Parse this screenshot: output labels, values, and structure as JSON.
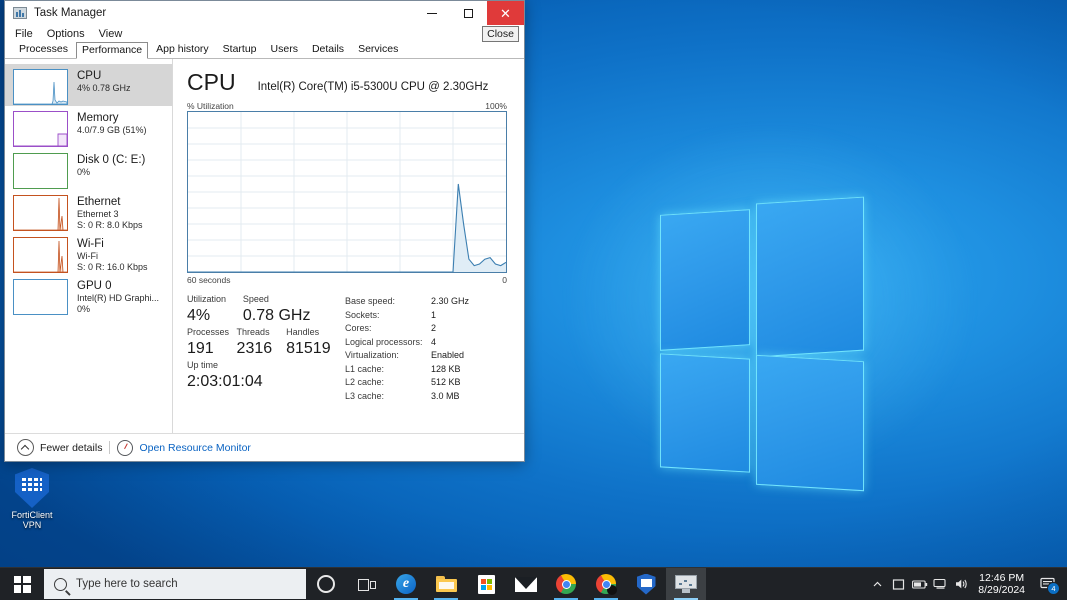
{
  "window": {
    "title": "Task Manager",
    "title_icon": "task-manager-icon",
    "minimize_label": "Minimize",
    "maximize_label": "Maximize",
    "close_label": "Close",
    "close_tooltip": "Close",
    "menus": [
      "File",
      "Options",
      "View"
    ],
    "tabs": [
      {
        "label": "Processes",
        "selected": false
      },
      {
        "label": "Performance",
        "selected": true
      },
      {
        "label": "App history",
        "selected": false
      },
      {
        "label": "Startup",
        "selected": false
      },
      {
        "label": "Users",
        "selected": false
      },
      {
        "label": "Details",
        "selected": false
      },
      {
        "label": "Services",
        "selected": false
      }
    ]
  },
  "sidebar": {
    "items": [
      {
        "title": "CPU",
        "sub1": "4%  0.78 GHz",
        "sub2": "",
        "color": "#4a90c4",
        "selected": true
      },
      {
        "title": "Memory",
        "sub1": "4.0/7.9 GB (51%)",
        "sub2": "",
        "color": "#9b4fc8",
        "selected": false
      },
      {
        "title": "Disk 0 (C: E:)",
        "sub1": "0%",
        "sub2": "",
        "color": "#4f9c4f",
        "selected": false
      },
      {
        "title": "Ethernet",
        "sub1": "Ethernet 3",
        "sub2": "S: 0 R: 8.0 Kbps",
        "color": "#c4521f",
        "selected": false
      },
      {
        "title": "Wi-Fi",
        "sub1": "Wi-Fi",
        "sub2": "S: 0 R: 16.0 Kbps",
        "color": "#c4521f",
        "selected": false
      },
      {
        "title": "GPU 0",
        "sub1": "Intel(R) HD Graphi...",
        "sub2": "0%",
        "color": "#4a90c4",
        "selected": false
      }
    ]
  },
  "cpu": {
    "heading": "CPU",
    "model": "Intel(R) Core(TM) i5-5300U CPU @ 2.30GHz",
    "graph_title": "% Utilization",
    "graph_max": "100%",
    "graph_duration": "60 seconds",
    "graph_min": "0",
    "stats": {
      "utilization_label": "Utilization",
      "utilization_value": "4%",
      "speed_label": "Speed",
      "speed_value": "0.78 GHz",
      "processes_label": "Processes",
      "processes_value": "191",
      "threads_label": "Threads",
      "threads_value": "2316",
      "handles_label": "Handles",
      "handles_value": "81519",
      "uptime_label": "Up time",
      "uptime_value": "2:03:01:04"
    },
    "details": [
      {
        "key": "Base speed:",
        "value": "2.30 GHz"
      },
      {
        "key": "Sockets:",
        "value": "1"
      },
      {
        "key": "Cores:",
        "value": "2"
      },
      {
        "key": "Logical processors:",
        "value": "4"
      },
      {
        "key": "Virtualization:",
        "value": "Enabled"
      },
      {
        "key": "L1 cache:",
        "value": "128 KB"
      },
      {
        "key": "L2 cache:",
        "value": "512 KB"
      },
      {
        "key": "L3 cache:",
        "value": "3.0 MB"
      }
    ]
  },
  "chart_data": {
    "type": "area",
    "title": "% Utilization",
    "xlabel": "60 seconds",
    "ylabel": "% Utilization",
    "ylim": [
      0,
      100
    ],
    "xlim": [
      60,
      0
    ],
    "grid": true,
    "legend": false,
    "axis_labels": {
      "y_top": "100%",
      "y_bottom": "0",
      "x_left": "60 seconds",
      "x_right": "0"
    },
    "line_color": "#3c7fb1",
    "fill_color": "#dbeaf4",
    "x": [
      60,
      59,
      58,
      57,
      56,
      55,
      54,
      53,
      52,
      51,
      50,
      49,
      48,
      47,
      46,
      45,
      44,
      43,
      42,
      41,
      40,
      39,
      38,
      37,
      36,
      35,
      34,
      33,
      32,
      31,
      30,
      29,
      28,
      27,
      26,
      25,
      24,
      23,
      22,
      21,
      20,
      19,
      18,
      17,
      16,
      15,
      14,
      13,
      12,
      11,
      10,
      9,
      8,
      7,
      6,
      5,
      4,
      3,
      2,
      1,
      0
    ],
    "values": [
      0,
      0,
      0,
      0,
      0,
      0,
      0,
      0,
      0,
      0,
      0,
      0,
      0,
      0,
      0,
      0,
      0,
      0,
      0,
      0,
      0,
      0,
      0,
      0,
      0,
      0,
      0,
      0,
      0,
      0,
      0,
      0,
      0,
      0,
      0,
      0,
      0,
      0,
      0,
      0,
      0,
      0,
      0,
      0,
      0,
      0,
      0,
      0,
      0,
      0,
      0,
      55,
      30,
      8,
      4,
      5,
      8,
      9,
      5,
      4,
      6
    ]
  },
  "statusbar": {
    "fewer_details": "Fewer details",
    "resource_monitor": "Open Resource Monitor"
  },
  "desktop": {
    "shortcut": {
      "label_line1": "FortiClient",
      "label_line2": "VPN",
      "icon": "forticlient-vpn-icon"
    }
  },
  "taskbar": {
    "start_icon": "windows-start-icon",
    "search_placeholder": "Type here to search",
    "search_icon": "search-icon",
    "items": [
      {
        "name": "cortana-icon",
        "label": "Cortana"
      },
      {
        "name": "task-view-icon",
        "label": "Task View"
      },
      {
        "name": "edge-icon",
        "label": "Microsoft Edge"
      },
      {
        "name": "file-explorer-icon",
        "label": "File Explorer"
      },
      {
        "name": "microsoft-store-icon",
        "label": "Microsoft Store"
      },
      {
        "name": "mail-icon",
        "label": "Mail"
      },
      {
        "name": "chrome-icon",
        "label": "Google Chrome"
      },
      {
        "name": "chrome-icon-2",
        "label": "Google Chrome"
      },
      {
        "name": "forticlient-icon",
        "label": "FortiClient"
      },
      {
        "name": "task-manager-icon",
        "label": "Task Manager"
      }
    ],
    "tray": {
      "show_hidden_icons": "show-hidden-icons-chevron",
      "icons": [
        "onedrive-icon",
        "battery-icon",
        "network-icon",
        "volume-icon"
      ],
      "time": "12:46 PM",
      "date": "8/29/2024",
      "notification_count": "4"
    }
  }
}
